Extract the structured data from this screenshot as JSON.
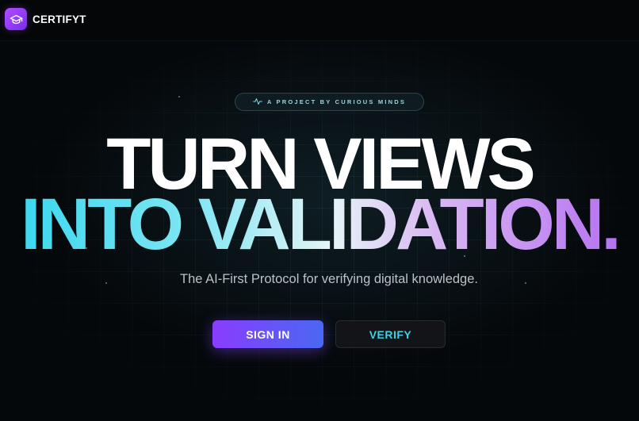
{
  "header": {
    "brand_name": "CERTIFYT",
    "logo_icon": "graduation-cap-icon"
  },
  "hero": {
    "badge": {
      "icon": "pulse-icon",
      "text": "A PROJECT BY CURIOUS MINDS"
    },
    "headline_line1": "TURN VIEWS",
    "headline_line2": "INTO VALIDATION.",
    "subtitle": "The AI-First Protocol for verifying digital knowledge."
  },
  "actions": {
    "sign_in_label": "SIGN IN",
    "verify_label": "VERIFY"
  },
  "colors": {
    "background": "#05080b",
    "brand_purple": "#9a3cff",
    "accent_cyan": "#33d6ee",
    "button_gradient_start": "#8a3cff",
    "button_gradient_end": "#4a68f2"
  }
}
